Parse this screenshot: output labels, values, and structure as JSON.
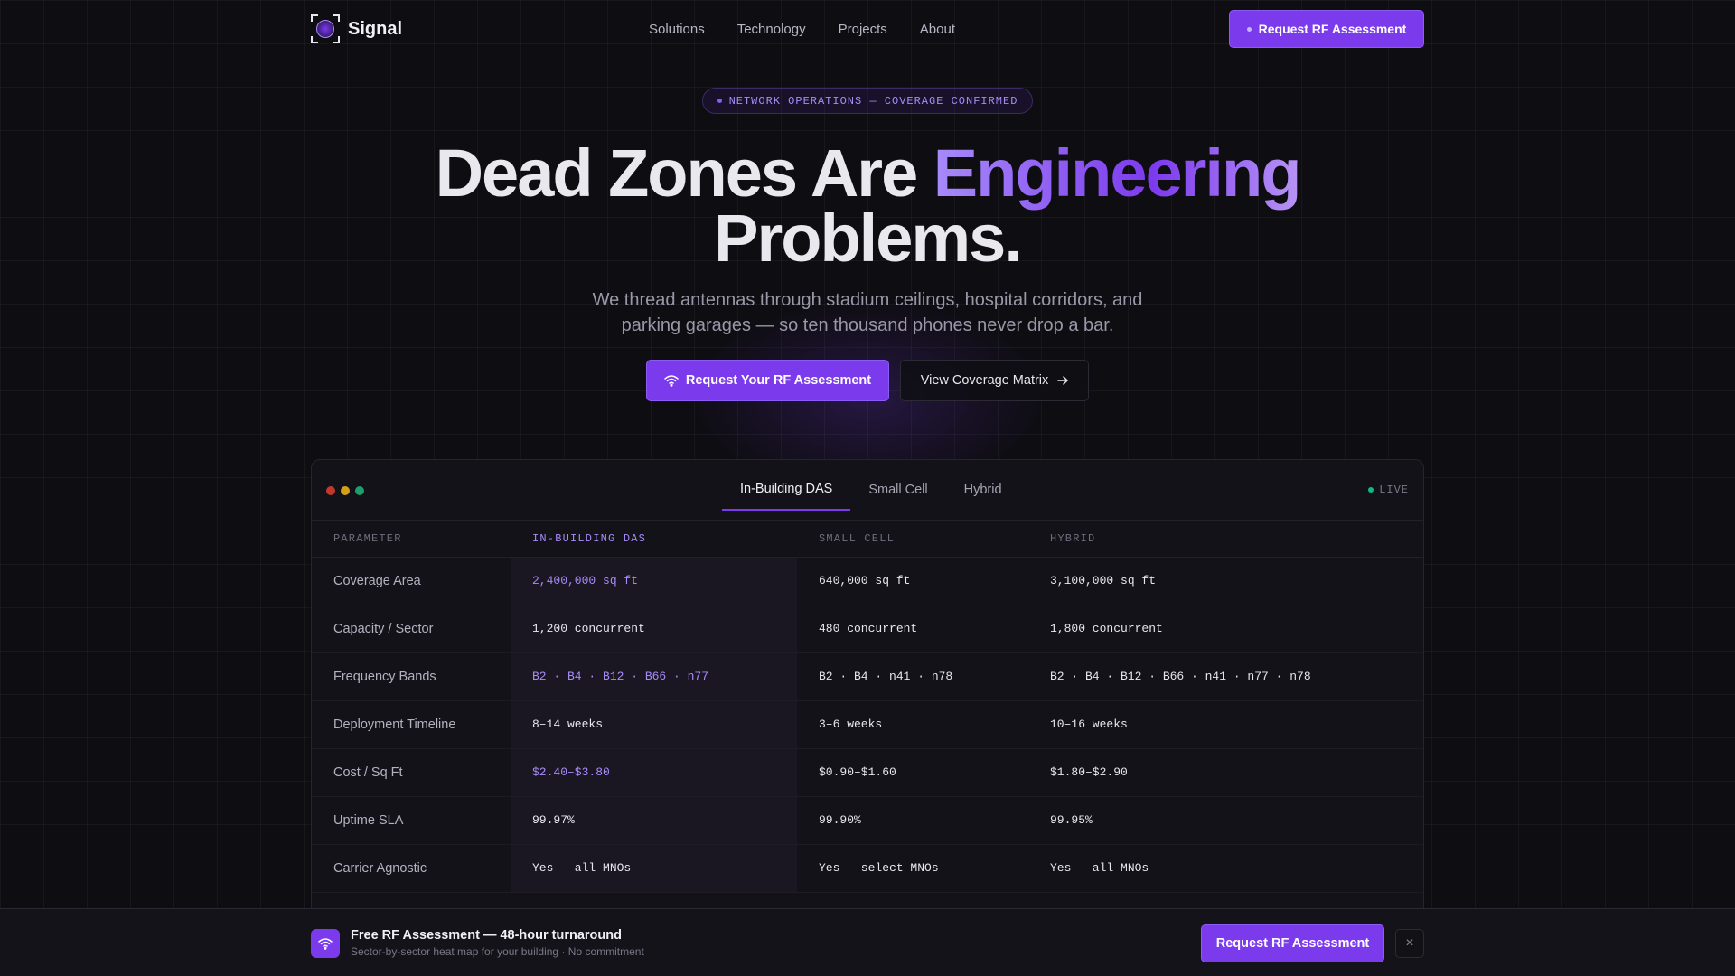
{
  "nav": {
    "brand": "Signal",
    "links": [
      "Solutions",
      "Technology",
      "Projects",
      "About"
    ],
    "cta": "Request RF Assessment"
  },
  "hero": {
    "badge": "NETWORK OPERATIONS — COVERAGE CONFIRMED",
    "title_part1": "Dead Zones Are ",
    "title_accent": "Engineering",
    "title_part2": "Problems.",
    "subtitle": "We thread antennas through stadium ceilings, hospital corridors, and parking garages — so ten thousand phones never drop a bar.",
    "cta_primary": "Request Your RF Assessment",
    "cta_secondary": "View Coverage Matrix"
  },
  "panel": {
    "tabs": [
      "In-Building DAS",
      "Small Cell",
      "Hybrid"
    ],
    "active_tab": 0,
    "live_label": "LIVE",
    "columns": [
      "PARAMETER",
      "IN-BUILDING DAS",
      "SMALL CELL",
      "HYBRID"
    ],
    "rows": [
      {
        "param": "Coverage Area",
        "das": "2,400,000 sq ft",
        "small": "640,000 sq ft",
        "hybrid": "3,100,000 sq ft",
        "accent": true
      },
      {
        "param": "Capacity / Sector",
        "das": "1,200 concurrent",
        "small": "480 concurrent",
        "hybrid": "1,800 concurrent",
        "accent": false
      },
      {
        "param": "Frequency Bands",
        "das": "B2 · B4 · B12 · B66 · n77",
        "small": "B2 · B4 · n41 · n78",
        "hybrid": "B2 · B4 · B12 · B66 · n41 · n77 · n78",
        "accent": true
      },
      {
        "param": "Deployment Timeline",
        "das": "8–14 weeks",
        "small": "3–6 weeks",
        "hybrid": "10–16 weeks",
        "accent": false
      },
      {
        "param": "Cost / Sq Ft",
        "das": "$2.40–$3.80",
        "small": "$0.90–$1.60",
        "hybrid": "$1.80–$2.90",
        "accent": true
      },
      {
        "param": "Uptime SLA",
        "das": "99.97%",
        "small": "99.90%",
        "hybrid": "99.95%",
        "accent": false
      },
      {
        "param": "Carrier Agnostic",
        "das": "Yes — all MNOs",
        "small": "Yes — select MNOs",
        "hybrid": "Yes — all MNOs",
        "accent": false
      }
    ]
  },
  "bottom_bar": {
    "title": "Free RF Assessment — 48-hour turnaround",
    "subtitle": "Sector-by-sector heat map for your building · No commitment",
    "cta": "Request RF Assessment",
    "close": "×"
  },
  "colors": {
    "accent": "#7c3aed",
    "accent_light": "#a78bfa",
    "live": "#10b981",
    "light_red": "#c0392b",
    "light_yellow": "#d4a017",
    "light_green": "#1f9d6b"
  },
  "icons": {
    "logo": "signal-logo-icon",
    "wifi": "wifi-icon",
    "arrow": "arrow-right-icon",
    "close": "close-icon"
  }
}
